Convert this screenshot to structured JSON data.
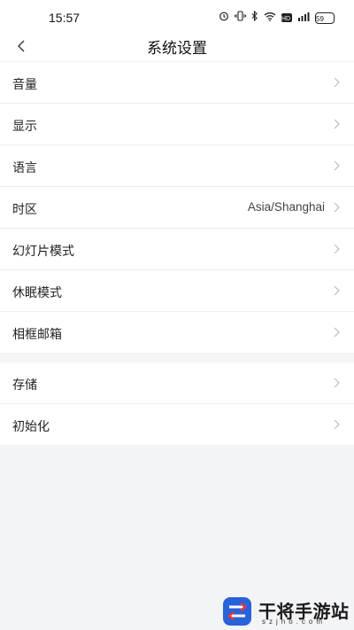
{
  "status_bar": {
    "time": "15:57",
    "battery": "59",
    "hd": "HD"
  },
  "header": {
    "title": "系统设置"
  },
  "group1": [
    {
      "label": "音量",
      "value": ""
    },
    {
      "label": "显示",
      "value": ""
    },
    {
      "label": "语言",
      "value": ""
    },
    {
      "label": "时区",
      "value": "Asia/Shanghai"
    },
    {
      "label": "幻灯片模式",
      "value": ""
    },
    {
      "label": "休眠模式",
      "value": ""
    },
    {
      "label": "相框邮箱",
      "value": ""
    }
  ],
  "group2": [
    {
      "label": "存储",
      "value": ""
    },
    {
      "label": "初始化",
      "value": ""
    }
  ],
  "watermark": {
    "title": "干将手游站",
    "subtitle": "szjho.com"
  }
}
